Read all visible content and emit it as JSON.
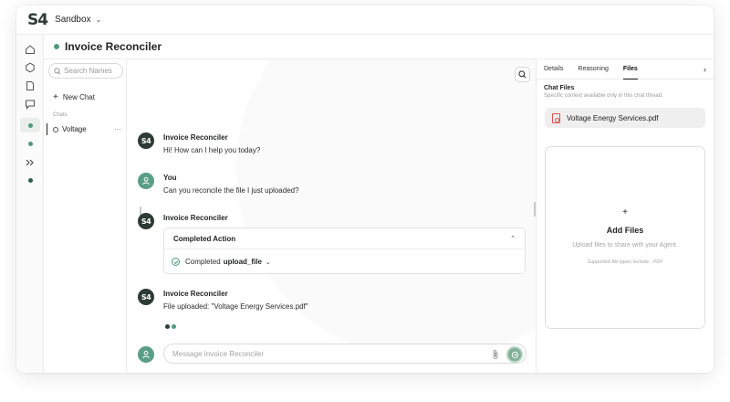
{
  "brand": {
    "logo": "S4",
    "workspace": "Sandbox"
  },
  "agent": {
    "title": "Invoice Reconciler"
  },
  "colors": {
    "accent": "#4f9a7d",
    "brand_dark": "#2e3a34",
    "user_avatar": "#5a9e86",
    "send_button": "#7fae96"
  },
  "sidebar": {
    "search_placeholder": "Search Names",
    "new_chat_label": "New Chat",
    "section_label": "Chats",
    "chats": [
      {
        "name": "Voltage",
        "more": "···"
      }
    ]
  },
  "thread": {
    "messages": [
      {
        "sender": "Invoice Reconciler",
        "avatar": "S4",
        "text": "Hi! How can I help you today?"
      },
      {
        "sender": "You",
        "avatar": "user-icon",
        "text": "Can you reconcile the file I just uploaded?"
      },
      {
        "sender": "Invoice Reconciler",
        "avatar": "S4",
        "text": ""
      },
      {
        "sender": "Invoice Reconciler",
        "avatar": "S4",
        "text": "File uploaded: \"Voltage Energy Services.pdf\""
      }
    ],
    "action": {
      "title": "Completed Action",
      "status": "Completed",
      "name": "upload_file"
    },
    "composer_placeholder": "Message Invoice Reconciler"
  },
  "right_panel": {
    "tabs": [
      "Details",
      "Reasoning",
      "Files"
    ],
    "active_tab": "Files",
    "chat_files_title": "Chat Files",
    "chat_files_subtitle": "Specific context available only in this chat thread.",
    "files": [
      {
        "name": "Voltage Energy Services.pdf",
        "icon": "pdf-file-icon"
      }
    ],
    "dropzone": {
      "plus": "+",
      "title": "Add Files",
      "subtitle": "Upload files to share with your Agent.",
      "supported": "Supported file types include: .PDF"
    }
  }
}
